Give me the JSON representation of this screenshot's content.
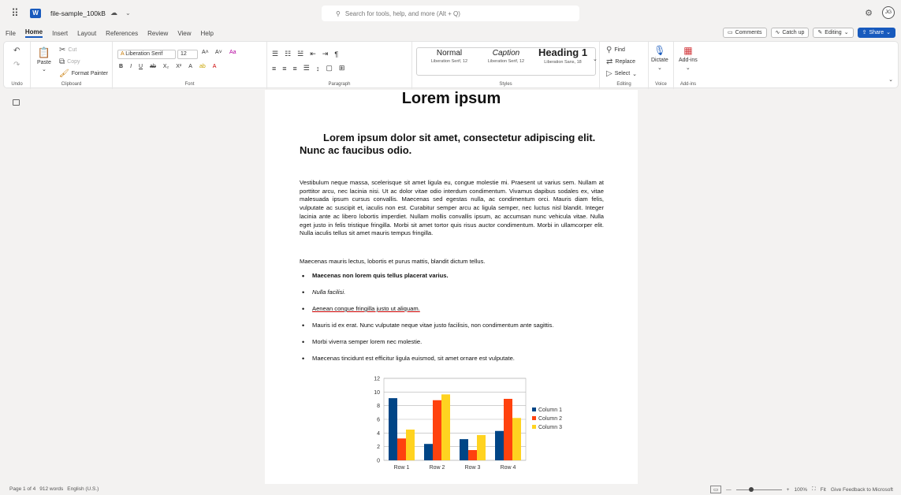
{
  "titlebar": {
    "file_name": "file-sample_100kB",
    "search_placeholder": "Search for tools, help, and more (Alt + Q)",
    "avatar_initials": "JG"
  },
  "tabs": [
    "File",
    "Home",
    "Insert",
    "Layout",
    "References",
    "Review",
    "View",
    "Help"
  ],
  "tab_actions": {
    "comments": "Comments",
    "catchup": "Catch up",
    "editing": "Editing",
    "share": "Share"
  },
  "ribbon": {
    "undo": "Undo",
    "clipboard": {
      "paste": "Paste",
      "cut": "Cut",
      "copy": "Copy",
      "format_painter": "Format Painter",
      "label": "Clipboard"
    },
    "font": {
      "family": "Liberation Serif",
      "size": "12",
      "label": "Font"
    },
    "paragraph_label": "Paragraph",
    "styles": {
      "items": [
        {
          "name": "Normal",
          "sub": "Liberation Serif, 12"
        },
        {
          "name": "Caption",
          "sub": "Liberation Serif, 12"
        },
        {
          "name": "Heading 1",
          "sub": "Liberation Sans, 18"
        }
      ],
      "label": "Styles"
    },
    "editing": {
      "find": "Find",
      "replace": "Replace",
      "select": "Select",
      "label": "Editing"
    },
    "voice": {
      "dictate": "Dictate",
      "label": "Voice"
    },
    "addins": {
      "addins": "Add-ins",
      "label": "Add-ins"
    }
  },
  "document": {
    "title": "Lorem ipsum",
    "subtitle": "Lorem ipsum dolor sit amet, consectetur adipiscing elit. Nunc ac faucibus odio.",
    "paragraph1": "Vestibulum neque massa, scelerisque sit amet ligula eu, congue molestie mi. Praesent ut varius sem. Nullam at porttitor arcu, nec lacinia nisi. Ut ac dolor vitae odio interdum condimentum. Vivamus dapibus sodales ex, vitae malesuada ipsum cursus convallis. Maecenas sed egestas nulla, ac condimentum orci. Mauris diam felis, vulputate ac suscipit et, iaculis non est. Curabitur semper arcu ac ligula semper, nec luctus nisl blandit. Integer lacinia ante ac libero lobortis imperdiet. Nullam mollis convallis ipsum, ac accumsan nunc vehicula vitae. Nulla eget justo in felis tristique fringilla. Morbi sit amet tortor quis risus auctor condimentum. Morbi in ullamcorper elit. Nulla iaculis tellus sit amet mauris tempus fringilla.",
    "paragraph2": "Maecenas mauris lectus, lobortis et purus mattis, blandit dictum tellus.",
    "bullets": [
      "Maecenas non lorem quis tellus placerat varius.",
      "Nulla facilisi.",
      "Aenean congue fringilla justo ut aliquam.",
      "Mauris id ex erat. Nunc vulputate neque vitae justo facilisis, non condimentum ante sagittis.",
      "Morbi viverra semper lorem nec molestie.",
      "Maecenas tincidunt est efficitur ligula euismod, sit amet ornare est vulputate."
    ]
  },
  "chart_data": {
    "type": "bar",
    "categories": [
      "Row 1",
      "Row 2",
      "Row 3",
      "Row 4"
    ],
    "series": [
      {
        "name": "Column 1",
        "values": [
          9.1,
          2.4,
          3.1,
          4.3
        ],
        "color": "#004586"
      },
      {
        "name": "Column 2",
        "values": [
          3.2,
          8.8,
          1.5,
          9.0
        ],
        "color": "#ff420e"
      },
      {
        "name": "Column 3",
        "values": [
          4.5,
          9.65,
          3.7,
          6.2
        ],
        "color": "#ffd320"
      }
    ],
    "yticks": [
      "0",
      "2",
      "4",
      "6",
      "8",
      "10",
      "12"
    ],
    "ylim": [
      0,
      12
    ],
    "grid": true,
    "legend": "right"
  },
  "statusbar": {
    "page": "Page 1 of 4",
    "words": "912 words",
    "language": "English (U.S.)",
    "zoom": "100%",
    "fit": "Fit",
    "feedback": "Give Feedback to Microsoft"
  }
}
